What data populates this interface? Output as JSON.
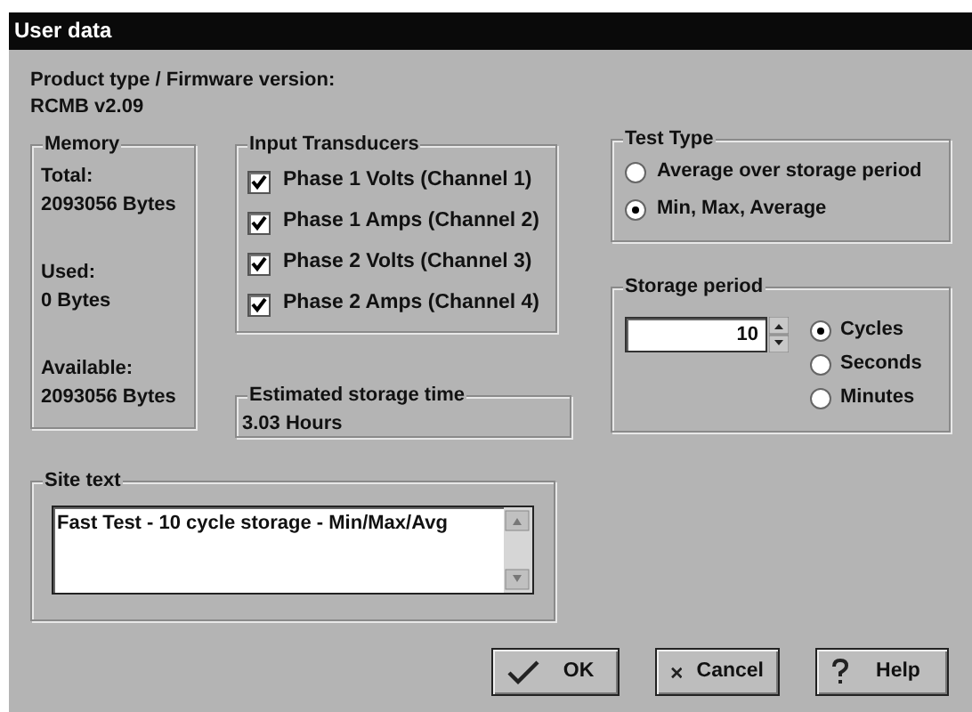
{
  "window": {
    "title": "User data"
  },
  "product": {
    "label": "Product type / Firmware version:",
    "value": "RCMB v2.09"
  },
  "memory": {
    "title": "Memory",
    "entries": [
      {
        "label": "Total:",
        "value": "2093056 Bytes"
      },
      {
        "label": "Used:",
        "value": "0 Bytes"
      },
      {
        "label": "Available:",
        "value": "2093056 Bytes"
      }
    ]
  },
  "input_transducers": {
    "title": "Input Transducers",
    "items": [
      {
        "label": "Phase 1 Volts (Channel 1)",
        "checked": true
      },
      {
        "label": "Phase 1 Amps (Channel 2)",
        "checked": true
      },
      {
        "label": "Phase 2 Volts (Channel 3)",
        "checked": true
      },
      {
        "label": "Phase 2 Amps (Channel 4)",
        "checked": true
      }
    ]
  },
  "estimated_storage_time": {
    "title": "Estimated storage time",
    "value": "3.03 Hours"
  },
  "test_type": {
    "title": "Test Type",
    "options": [
      {
        "label": "Average over storage period",
        "selected": false
      },
      {
        "label": "Min, Max, Average",
        "selected": true
      }
    ]
  },
  "storage_period": {
    "title": "Storage period",
    "value": "10",
    "units": [
      {
        "label": "Cycles",
        "selected": true
      },
      {
        "label": "Seconds",
        "selected": false
      },
      {
        "label": "Minutes",
        "selected": false
      }
    ]
  },
  "site_text": {
    "title": "Site text",
    "value": "Fast Test - 10 cycle storage - Min/Max/Avg"
  },
  "buttons": [
    {
      "kind": "ok",
      "label": "OK"
    },
    {
      "kind": "cancel",
      "label": "Cancel"
    },
    {
      "kind": "help",
      "label": "Help"
    }
  ]
}
